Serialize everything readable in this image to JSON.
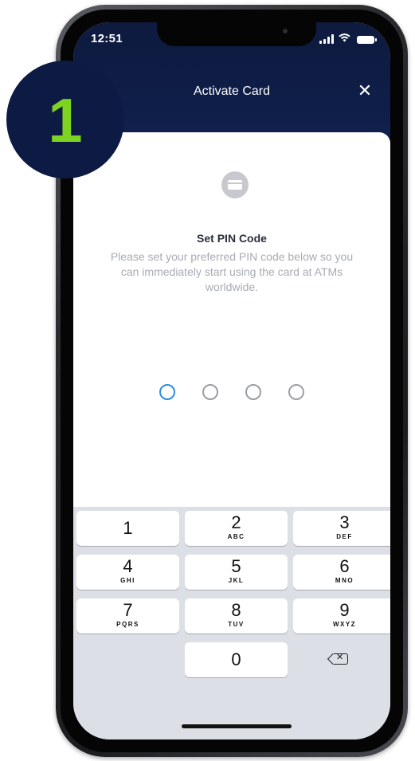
{
  "badge": {
    "number": "1"
  },
  "status_bar": {
    "time": "12:51"
  },
  "header": {
    "title": "Activate Card",
    "close_icon": "close-icon"
  },
  "content": {
    "icon": "card-icon",
    "title": "Set PIN Code",
    "description": "Please set your preferred PIN code below so you can immediately start using the card at ATMs worldwide.",
    "pin_length": 4,
    "pin_entered": 0
  },
  "keypad": {
    "keys": [
      {
        "digit": "1",
        "letters": ""
      },
      {
        "digit": "2",
        "letters": "ABC"
      },
      {
        "digit": "3",
        "letters": "DEF"
      },
      {
        "digit": "4",
        "letters": "GHI"
      },
      {
        "digit": "5",
        "letters": "JKL"
      },
      {
        "digit": "6",
        "letters": "MNO"
      },
      {
        "digit": "7",
        "letters": "PQRS"
      },
      {
        "digit": "8",
        "letters": "TUV"
      },
      {
        "digit": "9",
        "letters": "WXYZ"
      },
      {
        "digit": "0",
        "letters": ""
      }
    ],
    "backspace_icon": "backspace-icon"
  },
  "colors": {
    "header_navy": "#10214f",
    "badge_navy": "#0c1a44",
    "badge_green": "#7ed321",
    "active_pin": "#2a8fe0"
  }
}
